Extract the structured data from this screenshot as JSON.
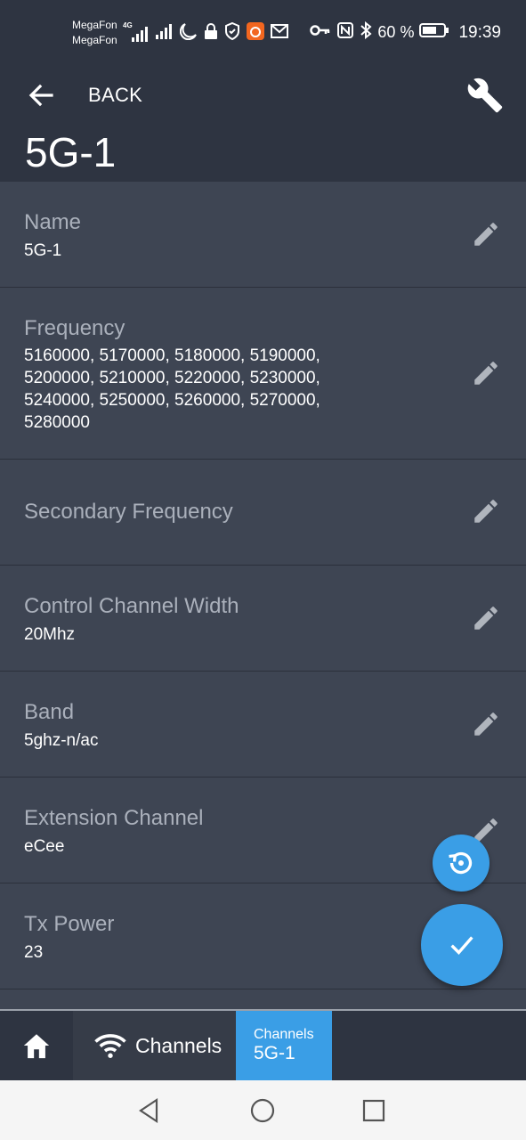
{
  "status_bar": {
    "carrier_1": "MegaFon",
    "carrier_2": "MegaFon",
    "network_type": "4G",
    "battery_percent": "60 %",
    "time": "19:39",
    "icons": [
      "signal-icon",
      "signal-icon",
      "moon-icon",
      "lock-icon",
      "shield-icon",
      "app-notification-icon",
      "mail-icon",
      "key-icon",
      "nfc-icon",
      "bluetooth-icon",
      "battery-icon"
    ]
  },
  "header": {
    "back_label": "BACK",
    "title": "5G-1",
    "back_icon": "arrow-left-icon",
    "tools_icon": "wrench-icon"
  },
  "fields": [
    {
      "label": "Name",
      "value": "5G-1"
    },
    {
      "label": "Frequency",
      "value": "5160000, 5170000, 5180000, 5190000, 5200000, 5210000, 5220000, 5230000, 5240000, 5250000, 5260000, 5270000, 5280000"
    },
    {
      "label": "Secondary Frequency",
      "value": ""
    },
    {
      "label": "Control Channel Width",
      "value": "20Mhz"
    },
    {
      "label": "Band",
      "value": "5ghz-n/ac"
    },
    {
      "label": "Extension Channel",
      "value": "eCee"
    },
    {
      "label": "Tx Power",
      "value": "23"
    }
  ],
  "fab": {
    "reset_icon": "restore-icon",
    "apply_icon": "check-icon"
  },
  "bottom_nav": {
    "home_icon": "home-icon",
    "channels_icon": "wifi-icon",
    "channels_label": "Channels",
    "current_top": "Channels",
    "current_bottom": "5G-1"
  },
  "colors": {
    "header_bg": "#2e3441",
    "content_bg": "#3e4553",
    "accent": "#3a9ee6",
    "label_gray": "#aab0bb"
  }
}
